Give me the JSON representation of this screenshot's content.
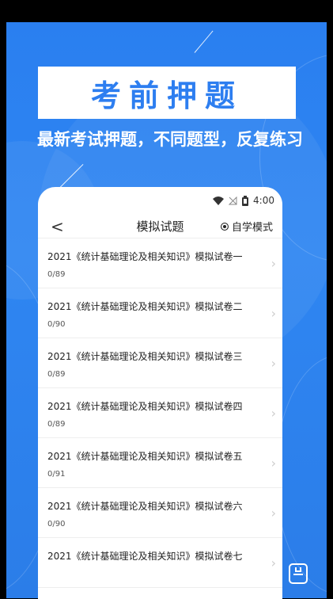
{
  "promo": {
    "banner_title": "考前押题",
    "subtitle": "最新考试押题，不同题型，反复练习"
  },
  "status_bar": {
    "time": "4:00",
    "icons": [
      "wifi-icon",
      "signal-off-icon",
      "battery-icon"
    ]
  },
  "header": {
    "back_label": "<",
    "title": "模拟试题",
    "mode_label": "自学模式"
  },
  "papers": [
    {
      "title": "2021《统计基础理论及相关知识》模拟试卷一",
      "progress": "0/89"
    },
    {
      "title": "2021《统计基础理论及相关知识》模拟试卷二",
      "progress": "0/90"
    },
    {
      "title": "2021《统计基础理论及相关知识》模拟试卷三",
      "progress": "0/89"
    },
    {
      "title": "2021《统计基础理论及相关知识》模拟试卷四",
      "progress": "0/89"
    },
    {
      "title": "2021《统计基础理论及相关知识》模拟试卷五",
      "progress": "0/91"
    },
    {
      "title": "2021《统计基础理论及相关知识》模拟试卷六",
      "progress": "0/90"
    },
    {
      "title": "2021《统计基础理论及相关知识》模拟试卷七",
      "progress": ""
    }
  ],
  "colors": {
    "accent": "#2d7ef0",
    "background": "#2a7ff0"
  }
}
